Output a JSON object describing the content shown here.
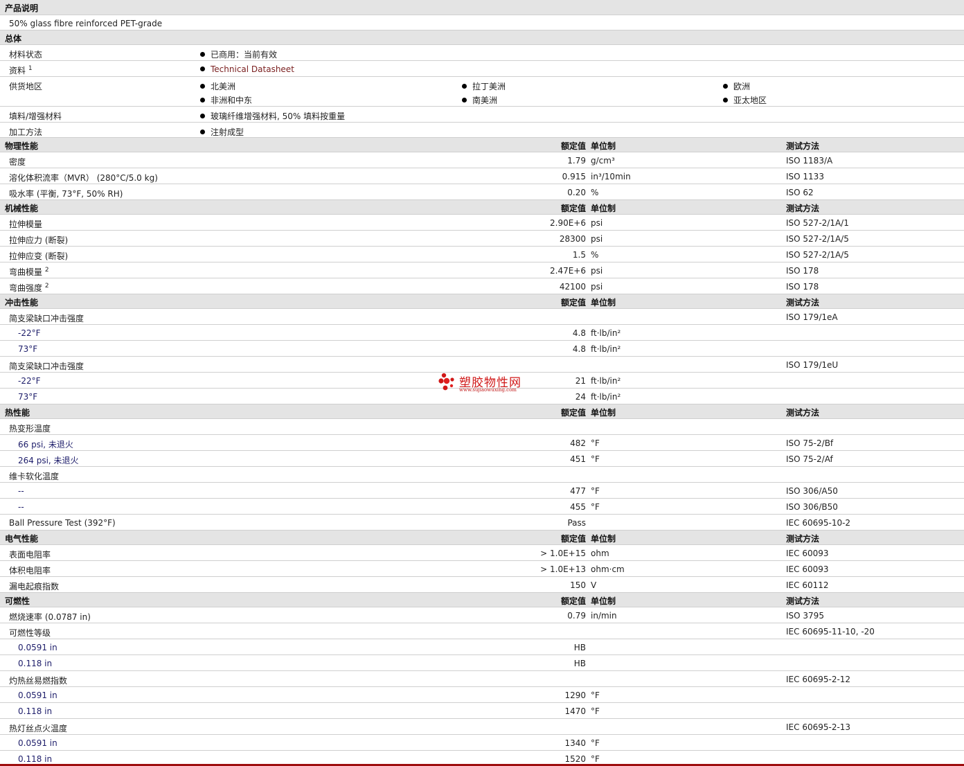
{
  "description": {
    "title": "产品说明",
    "text": "50% glass fibre reinforced PET-grade"
  },
  "general": {
    "title": "总体",
    "rows": [
      {
        "label": "材料状态",
        "items": [
          "已商用：当前有效"
        ]
      },
      {
        "label": "资料",
        "footnote": "1",
        "items": [
          "Technical Datasheet"
        ]
      },
      {
        "label": "供货地区",
        "items": [
          "北美洲",
          "拉丁美洲",
          "欧洲",
          "非洲和中东",
          "南美洲",
          "亚太地区"
        ]
      },
      {
        "label": "填料/增强材料",
        "items": [
          "玻璃纤维增强材料, 50% 填料按重量"
        ]
      },
      {
        "label": "加工方法",
        "items": [
          "注射成型"
        ]
      }
    ]
  },
  "columns": {
    "value": "额定值",
    "unit": "单位制",
    "method": "测试方法"
  },
  "sections": [
    {
      "title": "物理性能",
      "rows": [
        {
          "label": "密度",
          "value": "1.79",
          "unit": "g/cm³",
          "method": "ISO 1183/A"
        },
        {
          "label": "溶化体积流率（MVR） (280°C/5.0 kg)",
          "value": "0.915",
          "unit": "in³/10min",
          "method": "ISO 1133"
        },
        {
          "label": "吸水率 (平衡, 73°F, 50% RH)",
          "value": "0.20",
          "unit": "%",
          "method": "ISO 62"
        }
      ]
    },
    {
      "title": "机械性能",
      "rows": [
        {
          "label": "拉伸模量",
          "value": "2.90E+6",
          "unit": "psi",
          "method": "ISO 527-2/1A/1"
        },
        {
          "label": "拉伸应力 (断裂)",
          "value": "28300",
          "unit": "psi",
          "method": "ISO 527-2/1A/5"
        },
        {
          "label": "拉伸应变 (断裂)",
          "value": "1.5",
          "unit": "%",
          "method": "ISO 527-2/1A/5"
        },
        {
          "label": "弯曲模量",
          "footnote": "2",
          "value": "2.47E+6",
          "unit": "psi",
          "method": "ISO 178"
        },
        {
          "label": "弯曲强度",
          "footnote": "2",
          "value": "42100",
          "unit": "psi",
          "method": "ISO 178"
        }
      ]
    },
    {
      "title": "冲击性能",
      "rows": [
        {
          "label": "简支梁缺口冲击强度",
          "value": "",
          "unit": "",
          "method": "ISO 179/1eA"
        },
        {
          "label": "-22°F",
          "sub": true,
          "value": "4.8",
          "unit": "ft·lb/in²",
          "method": ""
        },
        {
          "label": "73°F",
          "sub": true,
          "value": "4.8",
          "unit": "ft·lb/in²",
          "method": ""
        },
        {
          "label": "简支梁缺口冲击强度",
          "value": "",
          "unit": "",
          "method": "ISO 179/1eU"
        },
        {
          "label": "-22°F",
          "sub": true,
          "value": "21",
          "unit": "ft·lb/in²",
          "method": ""
        },
        {
          "label": "73°F",
          "sub": true,
          "value": "24",
          "unit": "ft·lb/in²",
          "method": ""
        }
      ]
    },
    {
      "title": "热性能",
      "rows": [
        {
          "label": "热变形温度",
          "value": "",
          "unit": "",
          "method": ""
        },
        {
          "label": "66 psi, 未退火",
          "sub": true,
          "value": "482",
          "unit": "°F",
          "method": "ISO 75-2/Bf"
        },
        {
          "label": "264 psi, 未退火",
          "sub": true,
          "value": "451",
          "unit": "°F",
          "method": "ISO 75-2/Af"
        },
        {
          "label": "维卡软化温度",
          "value": "",
          "unit": "",
          "method": ""
        },
        {
          "label": "--",
          "sub": true,
          "value": "477",
          "unit": "°F",
          "method": "ISO 306/A50"
        },
        {
          "label": "--",
          "sub": true,
          "value": "455",
          "unit": "°F",
          "method": "ISO 306/B50"
        },
        {
          "label": "Ball Pressure Test (392°F)",
          "value": "Pass",
          "unit": "",
          "method": "IEC 60695-10-2"
        }
      ]
    },
    {
      "title": "电气性能",
      "rows": [
        {
          "label": "表面电阻率",
          "value": "> 1.0E+15",
          "unit": "ohm",
          "method": "IEC 60093"
        },
        {
          "label": "体积电阻率",
          "value": "> 1.0E+13",
          "unit": "ohm·cm",
          "method": "IEC 60093"
        },
        {
          "label": "漏电起痕指数",
          "value": "150",
          "unit": "V",
          "method": "IEC 60112"
        }
      ]
    },
    {
      "title": "可燃性",
      "rows": [
        {
          "label": "燃烧速率 (0.0787 in)",
          "value": "0.79",
          "unit": "in/min",
          "method": "ISO 3795"
        },
        {
          "label": "可燃性等级",
          "value": "",
          "unit": "",
          "method": "IEC 60695-11-10, -20"
        },
        {
          "label": "0.0591 in",
          "sub": true,
          "value": "HB",
          "unit": "",
          "method": ""
        },
        {
          "label": "0.118 in",
          "sub": true,
          "value": "HB",
          "unit": "",
          "method": ""
        },
        {
          "label": "灼热丝易燃指数",
          "value": "",
          "unit": "",
          "method": "IEC 60695-2-12"
        },
        {
          "label": "0.0591 in",
          "sub": true,
          "value": "1290",
          "unit": "°F",
          "method": ""
        },
        {
          "label": "0.118 in",
          "sub": true,
          "value": "1470",
          "unit": "°F",
          "method": ""
        },
        {
          "label": "热灯丝点火温度",
          "value": "",
          "unit": "",
          "method": "IEC 60695-2-13"
        },
        {
          "label": "0.0591 in",
          "sub": true,
          "value": "1340",
          "unit": "°F",
          "method": ""
        },
        {
          "label": "0.118 in",
          "sub": true,
          "value": "1520",
          "unit": "°F",
          "method": ""
        }
      ]
    }
  ],
  "watermark": {
    "text": "塑胶物性网",
    "url": "www.sujiaowuxing.com"
  },
  "colors": {
    "header_bg": "#e4e4e4",
    "accent": "#9e0d0d",
    "link": "#7a1f1f",
    "watermark": "#d01818"
  }
}
